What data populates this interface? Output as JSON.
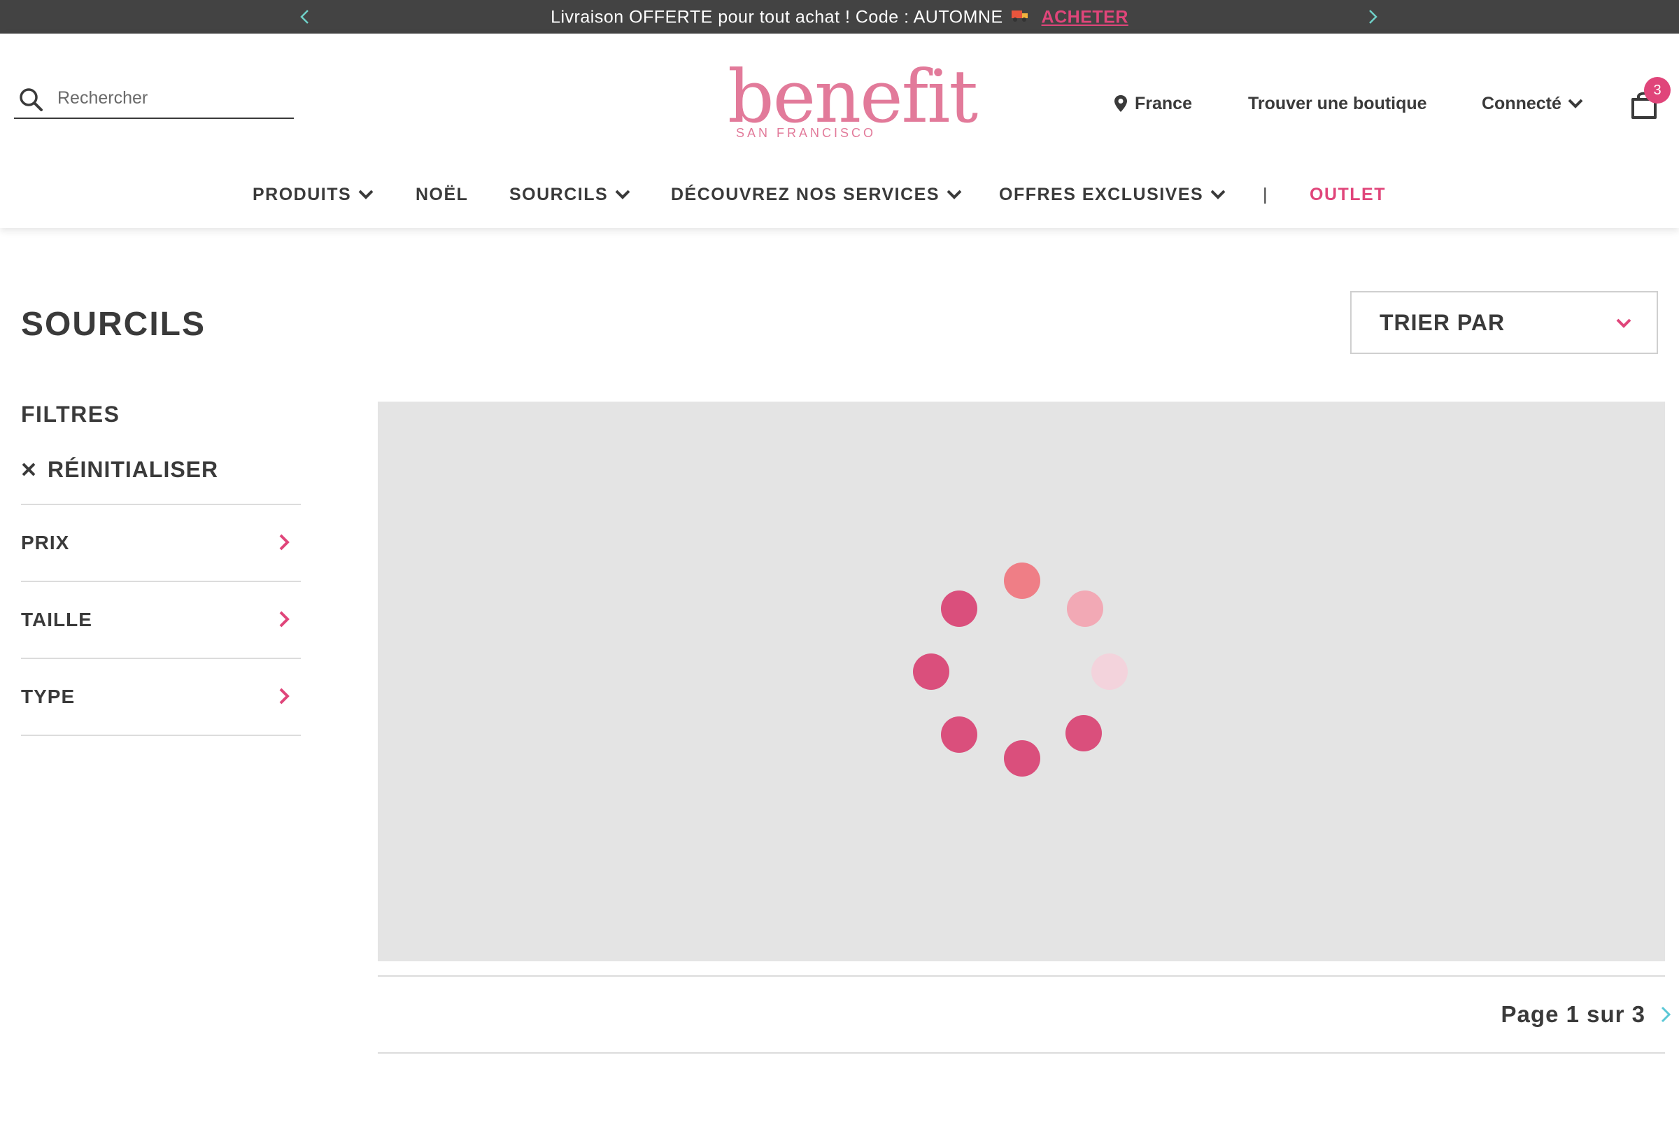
{
  "promo": {
    "message": "Livraison OFFERTE pour tout achat !  Code : AUTOMNE",
    "cta": "ACHETER",
    "truck_icon": "truck-icon",
    "prev_icon": "chevron-left-icon",
    "next_icon": "chevron-right-icon"
  },
  "header": {
    "search_placeholder": "Rechercher",
    "logo_word": "benefit",
    "logo_sub": "SAN FRANCISCO",
    "country": "France",
    "store_locator": "Trouver une boutique",
    "account": "Connecté",
    "cart_count": "3"
  },
  "nav": {
    "items": [
      {
        "label": "PRODUITS",
        "dropdown": true
      },
      {
        "label": "NOËL",
        "dropdown": false
      },
      {
        "label": "SOURCILS",
        "dropdown": true
      },
      {
        "label": "DÉCOUVREZ NOS SERVICES",
        "dropdown": true
      },
      {
        "label": "OFFRES EXCLUSIVES",
        "dropdown": true
      },
      {
        "label": "|",
        "dropdown": false
      },
      {
        "label": "OUTLET",
        "dropdown": false
      }
    ]
  },
  "page": {
    "title": "SOURCILS",
    "sort_label": "TRIER PAR"
  },
  "filters": {
    "title": "FILTRES",
    "reset": "RÉINITIALISER",
    "facets": [
      "PRIX",
      "TAILLE",
      "TYPE"
    ]
  },
  "pagination": {
    "label": "Page 1 sur 3"
  },
  "colors": {
    "brand_pink": "#e0457a",
    "logo_pink": "#e27a9a",
    "promo_bg": "#434343",
    "loader_area": "#e4e4e4",
    "pager_arrow": "#5bc8d6"
  }
}
